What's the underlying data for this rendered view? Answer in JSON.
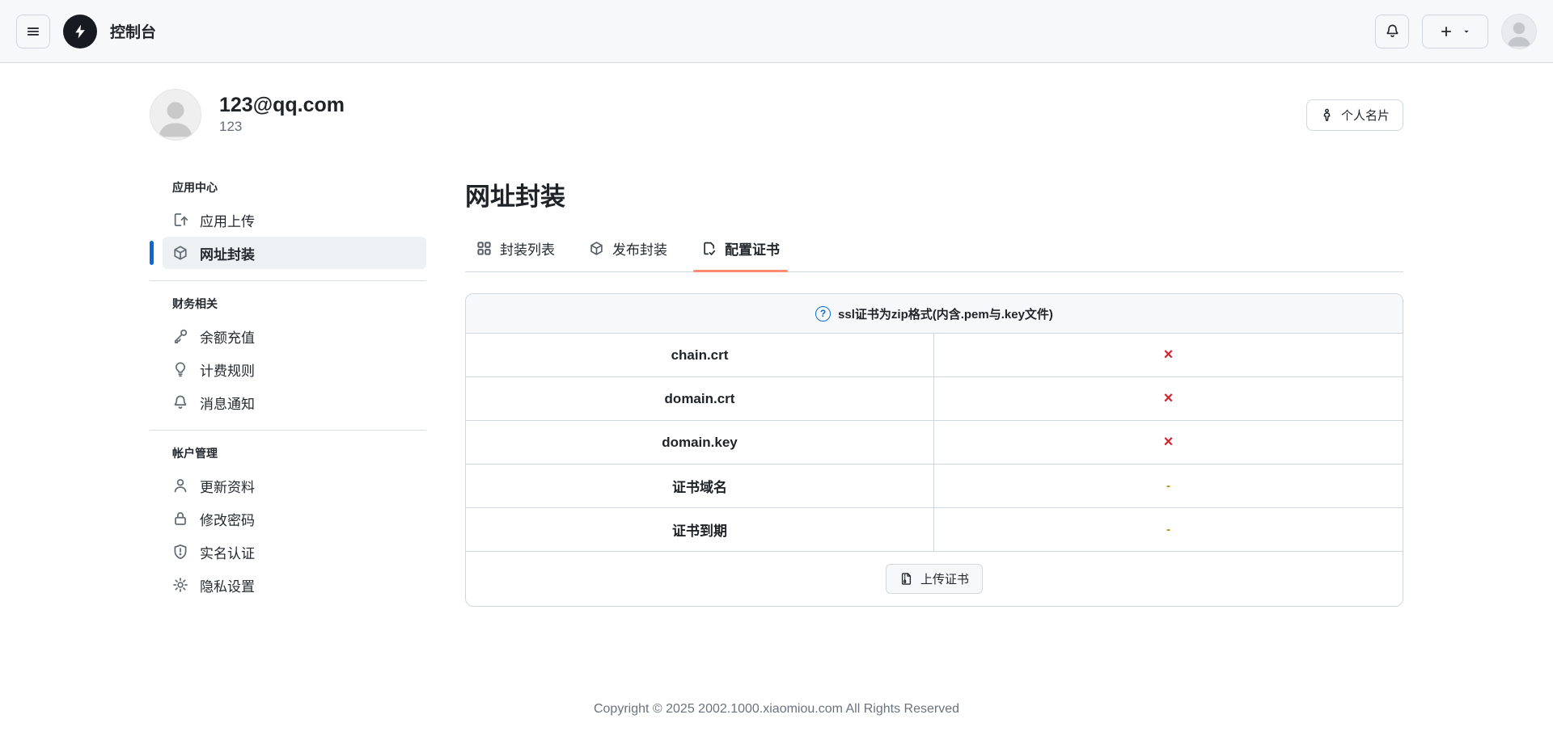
{
  "topbar": {
    "title": "控制台"
  },
  "profile": {
    "email": "123@qq.com",
    "username": "123",
    "card_button_label": "个人名片"
  },
  "sidebar": {
    "sections": [
      {
        "header": "应用中心",
        "items": [
          {
            "label": "应用上传",
            "icon": "upload-icon",
            "active": false
          },
          {
            "label": "网址封装",
            "icon": "package-icon",
            "active": true
          }
        ]
      },
      {
        "header": "财务相关",
        "items": [
          {
            "label": "余额充值",
            "icon": "key-icon",
            "active": false
          },
          {
            "label": "计费规则",
            "icon": "lightbulb-icon",
            "active": false
          },
          {
            "label": "消息通知",
            "icon": "bell-icon",
            "active": false
          }
        ]
      },
      {
        "header": "帐户管理",
        "items": [
          {
            "label": "更新资料",
            "icon": "person-icon",
            "active": false
          },
          {
            "label": "修改密码",
            "icon": "lock-icon",
            "active": false
          },
          {
            "label": "实名认证",
            "icon": "shield-icon",
            "active": false
          },
          {
            "label": "隐私设置",
            "icon": "gear-icon",
            "active": false
          }
        ]
      }
    ]
  },
  "main": {
    "title": "网址封装",
    "tabs": [
      {
        "label": "封装列表",
        "icon": "grid-icon",
        "active": false
      },
      {
        "label": "发布封装",
        "icon": "package-icon",
        "active": false
      },
      {
        "label": "配置证书",
        "icon": "file-check-icon",
        "active": true
      }
    ],
    "cert_table": {
      "help_symbol": "?",
      "header": "ssl证书为zip格式(内含.pem与.key文件)",
      "rows": [
        {
          "label": "chain.crt",
          "status": "×",
          "status_type": "missing"
        },
        {
          "label": "domain.crt",
          "status": "×",
          "status_type": "missing"
        },
        {
          "label": "domain.key",
          "status": "×",
          "status_type": "missing"
        },
        {
          "label": "证书域名",
          "status": "-",
          "status_type": "empty"
        },
        {
          "label": "证书到期",
          "status": "-",
          "status_type": "empty"
        }
      ],
      "upload_button_label": "上传证书"
    }
  },
  "footer": {
    "copyright": "Copyright © 2025 2002.1000.xiaomiou.com All Rights Reserved"
  },
  "colors": {
    "accent_blue": "#0969da",
    "error_red": "#d1242f",
    "warning_gold": "#bf8700",
    "tab_underline_coral": "#fd8c73",
    "header_bg": "#f6f8fa",
    "border": "#d0d7de"
  }
}
